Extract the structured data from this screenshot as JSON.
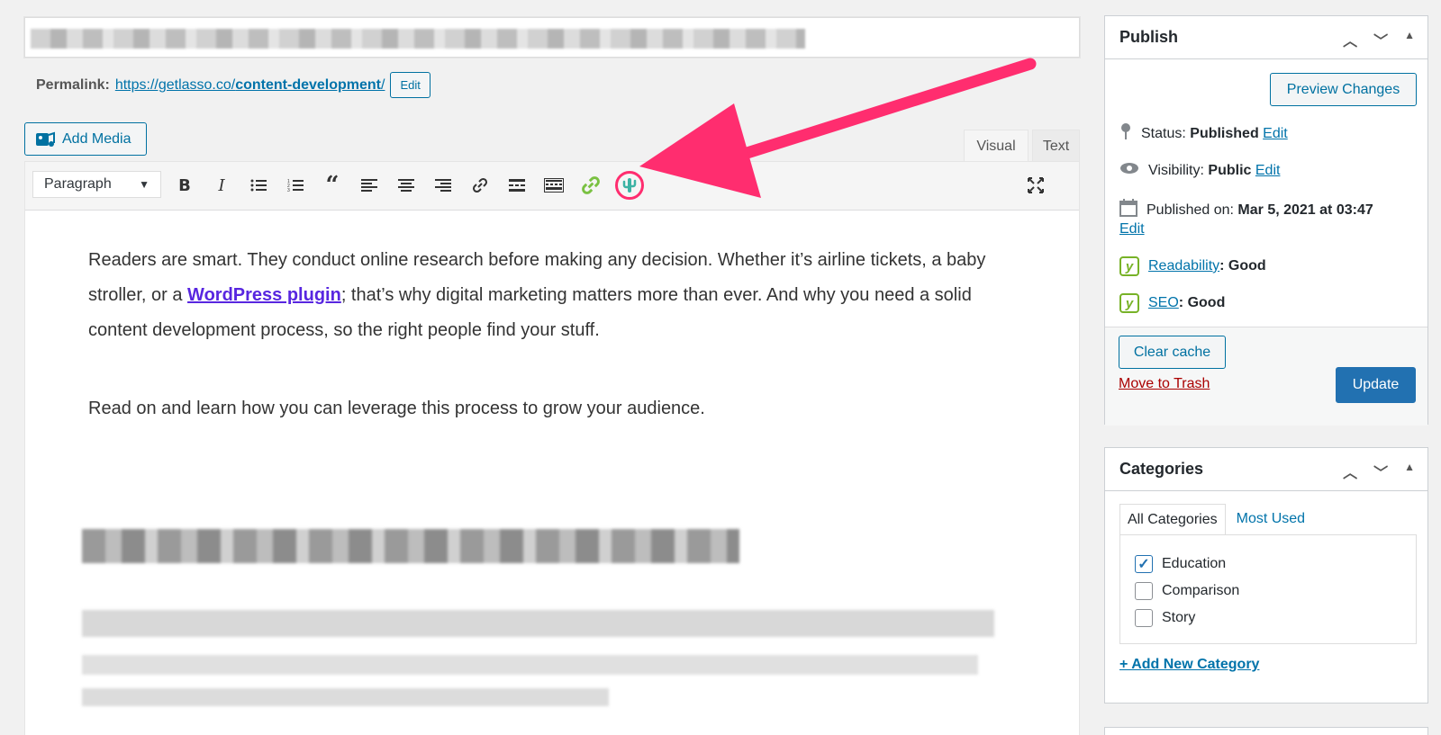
{
  "permalink": {
    "label": "Permalink:",
    "url_base": "https://getlasso.co/",
    "url_slug": "content-development",
    "url_end": "/",
    "edit_label": "Edit"
  },
  "add_media_label": "Add Media",
  "editor_tabs": {
    "visual": "Visual",
    "text": "Text"
  },
  "toolbar": {
    "format": "Paragraph"
  },
  "content": {
    "p1_part1": "Readers are smart. They conduct online research before making any decision. Whether it’s airline tickets, a baby stroller, or a ",
    "p1_link": "WordPress plugin",
    "p1_part2": "; that’s why digital marketing matters more than ever. And why you need a solid content development process, so the right people find your stuff.",
    "p2": "Read on and learn how you can leverage this process to grow your audience."
  },
  "publish": {
    "title": "Publish",
    "preview_label": "Preview Changes",
    "status_label": "Status:",
    "status_value": "Published",
    "visibility_label": "Visibility:",
    "visibility_value": "Public",
    "published_label": "Published on:",
    "published_value": "Mar 5, 2021 at 03:47",
    "edit_label": "Edit",
    "readability_label": "Readability",
    "readability_value": ": Good",
    "seo_label": "SEO",
    "seo_value": ": Good",
    "clear_cache_label": "Clear cache",
    "trash_label": "Move to Trash",
    "update_label": "Update"
  },
  "categories": {
    "title": "Categories",
    "tab_all": "All Categories",
    "tab_used": "Most Used",
    "items": [
      {
        "label": "Education",
        "checked": true
      },
      {
        "label": "Comparison",
        "checked": false
      },
      {
        "label": "Story",
        "checked": false
      }
    ],
    "add_label": "+ Add New Category"
  },
  "colors": {
    "accent": "#0073aa",
    "primary": "#2271b1",
    "annotation": "#ff2d6f",
    "lasso_icon": "#3bb3a4"
  }
}
